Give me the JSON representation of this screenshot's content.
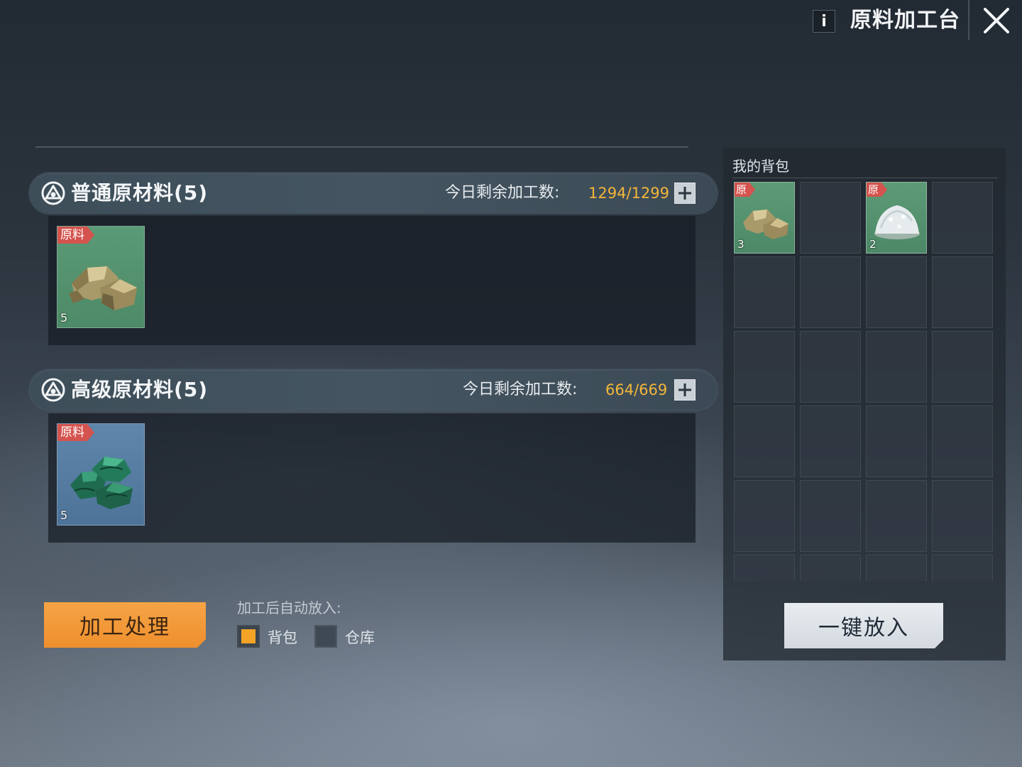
{
  "header": {
    "info_label": "i",
    "title": "原料加工台",
    "close_icon": "close-icon"
  },
  "sections": [
    {
      "title": "普通原材料(5)",
      "quota_label": "今日剩余加工数:",
      "quota_value": "1294/1299",
      "item": {
        "tag": "原料",
        "count": "5",
        "icon": "gold-ore-icon",
        "color": "#5b9a76"
      }
    },
    {
      "title": "高级原材料(5)",
      "quota_label": "今日剩余加工数:",
      "quota_value": "664/669",
      "item": {
        "tag": "原料",
        "count": "5",
        "icon": "green-ore-icon",
        "color": "#5f86ab"
      }
    }
  ],
  "controls": {
    "process_button": "加工处理",
    "auto_put_label": "加工后自动放入:",
    "options": [
      {
        "label": "背包",
        "checked": true
      },
      {
        "label": "仓库",
        "checked": false
      }
    ]
  },
  "backpack": {
    "title": "我的背包",
    "items": [
      {
        "tag": "原",
        "count": "3",
        "icon": "gold-ore-icon"
      },
      null,
      {
        "tag": "原",
        "count": "2",
        "icon": "white-powder-icon"
      },
      null
    ],
    "one_click_button": "一键放入"
  },
  "colors": {
    "accent_orange": "#f3a326",
    "quota_value": "#f3b63a",
    "tag_red": "#d4534e"
  }
}
